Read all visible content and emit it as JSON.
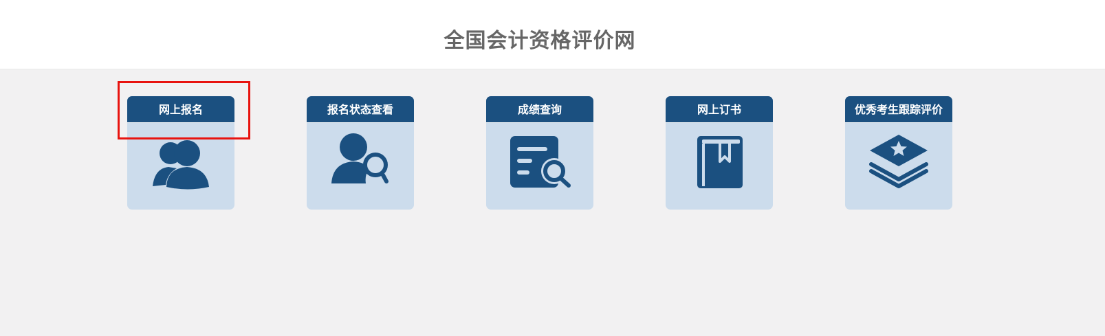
{
  "site": {
    "title": "全国会计资格评价网"
  },
  "cards": [
    {
      "label": "网上报名",
      "icon": "users-icon"
    },
    {
      "label": "报名状态查看",
      "icon": "user-search-icon"
    },
    {
      "label": "成绩查询",
      "icon": "document-search-icon"
    },
    {
      "label": "网上订书",
      "icon": "book-icon"
    },
    {
      "label": "优秀考生跟踪评价",
      "icon": "layers-star-icon"
    }
  ],
  "colors": {
    "accent": "#1b5080",
    "card_bg": "#ccdcec",
    "page_bg": "#f2f1f2",
    "highlight": "#e8130f"
  }
}
